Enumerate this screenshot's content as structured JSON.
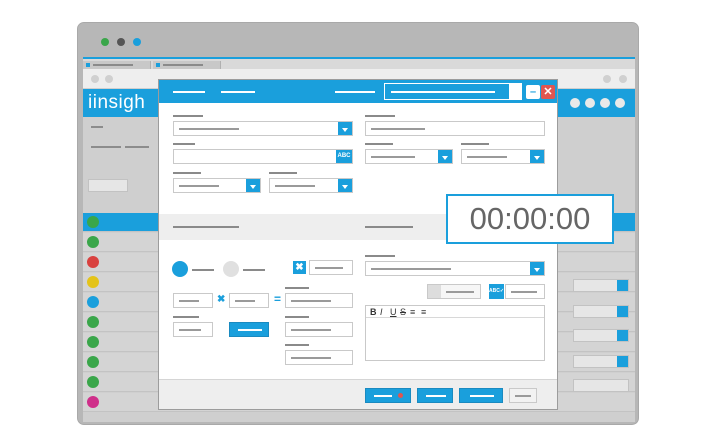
{
  "app": {
    "logo_text": "iinsigh"
  },
  "colors": {
    "accent": "#1a9fdc",
    "traffic_green": "#3aa64a",
    "traffic_gray": "#555555",
    "traffic_blue": "#1a9fdc",
    "close_red": "#e05550"
  },
  "modal": {
    "header_buttons": {
      "minimize_symbol": "–",
      "close_symbol": "✕"
    },
    "editor_tools": [
      "B",
      "I",
      "U",
      "S",
      "≡",
      "≡"
    ],
    "x_symbol": "✖",
    "equals_symbol": "="
  },
  "timer": {
    "value": "00:00:00"
  },
  "icons": {
    "spell_check": "ABC✓",
    "remove": "close-icon",
    "dropdown": "chevron-down-icon"
  }
}
